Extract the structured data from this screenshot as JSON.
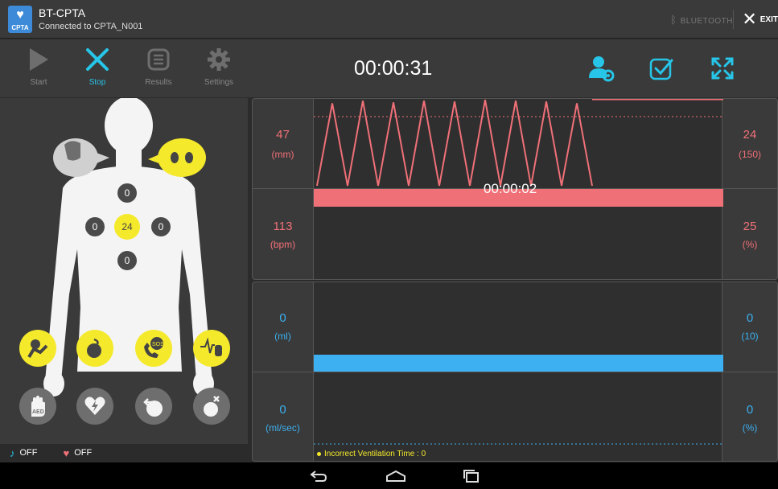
{
  "app": {
    "title": "BT-CPTA",
    "subtitle": "Connected to CPTA_N001",
    "icon_tag": "CPTA",
    "bluetooth_label": "BLUETOOTH",
    "exit_label": "EXIT"
  },
  "toolbar": {
    "start_label": "Start",
    "stop_label": "Stop",
    "results_label": "Results",
    "settings_label": "Settings",
    "timer": "00:00:31"
  },
  "body": {
    "points": {
      "top": "0",
      "left": "0",
      "center": "24",
      "right": "0",
      "bottom": "0"
    }
  },
  "status": {
    "left_label": "OFF",
    "right_label": "OFF"
  },
  "compression": {
    "depth_value": "47",
    "depth_unit": "(mm)",
    "rate_value": "113",
    "rate_unit": "(bpm)",
    "count_value": "24",
    "count_sub": "(150)",
    "percent_value": "25",
    "percent_unit": "(%)",
    "overlay_time": "00:00:02",
    "depth_trace": [
      0.0,
      0.95,
      0.0,
      0.98,
      0.0,
      0.96,
      0.0,
      0.98,
      0.0,
      0.97,
      0.0,
      0.99,
      0.0,
      0.98,
      0.0,
      0.97,
      0.0,
      0.95,
      0.0
    ]
  },
  "ventilation": {
    "volume_value": "0",
    "volume_unit": "(ml)",
    "flow_value": "0",
    "flow_unit": "(ml/sec)",
    "count_value": "0",
    "count_sub": "(10)",
    "percent_value": "0",
    "percent_unit": "(%)",
    "warning": "Incorrect Ventilation Time : 0"
  },
  "colors": {
    "accent": "#27c5e8",
    "yellow": "#f5e92c",
    "red": "#f07078",
    "blue": "#3cb0f0"
  }
}
